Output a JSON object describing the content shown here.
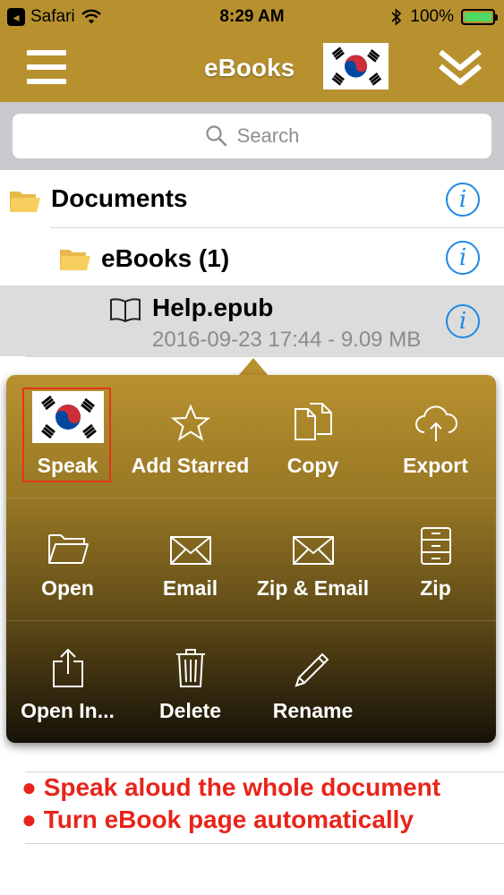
{
  "status_bar": {
    "back_app": "Safari",
    "time": "8:29 AM",
    "battery_percent": "100%",
    "battery_level": 1.0
  },
  "nav": {
    "title": "eBooks",
    "menu_icon": "hamburger-icon",
    "collapse_icon": "chevron-double-down-icon",
    "flag_icon": "korea-flag-icon"
  },
  "search": {
    "placeholder": "Search",
    "icon": "search-icon"
  },
  "list": {
    "documents_label": "Documents",
    "ebooks_label": "eBooks (1)",
    "file_name": "Help.epub",
    "file_meta": "2016-09-23 17:44 - 9.09 MB",
    "info_glyph": "i"
  },
  "popup": {
    "rows": [
      [
        {
          "label": "Speak",
          "icon": "korea-flag-icon"
        },
        {
          "label": "Add Starred",
          "icon": "star-icon"
        },
        {
          "label": "Copy",
          "icon": "copy-icon"
        },
        {
          "label": "Export",
          "icon": "cloud-upload-icon"
        }
      ],
      [
        {
          "label": "Open",
          "icon": "folder-open-icon"
        },
        {
          "label": "Email",
          "icon": "envelope-icon"
        },
        {
          "label": "Zip & Email",
          "icon": "envelope-icon"
        },
        {
          "label": "Zip",
          "icon": "archive-icon"
        }
      ],
      [
        {
          "label": "Open In...",
          "icon": "share-icon"
        },
        {
          "label": "Delete",
          "icon": "trash-icon"
        },
        {
          "label": "Rename",
          "icon": "pencil-icon"
        }
      ]
    ]
  },
  "annotations": {
    "line1": "● Speak aloud the whole document",
    "line2": "● Turn eBook page automatically"
  },
  "colors": {
    "bar_gold": "#b8912f",
    "info_blue": "#1e88e5",
    "annotation_red": "#e8241a",
    "highlight_red": "#e53519"
  }
}
